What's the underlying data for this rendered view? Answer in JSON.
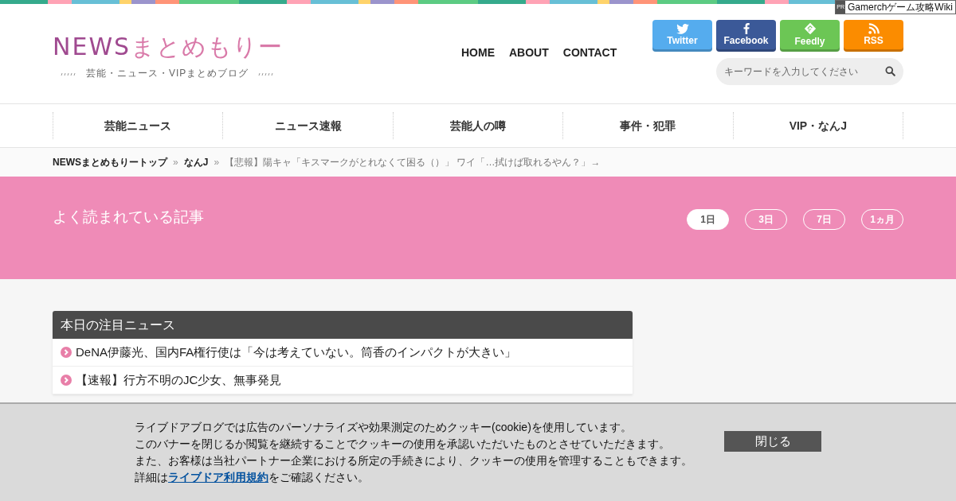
{
  "ad": {
    "mark": "PR",
    "text": "Gamerchゲーム攻略Wiki"
  },
  "header": {
    "logo_latin": "NEWS",
    "logo_kana": "まとめもりー",
    "tagline": "芸能・ニュース・VIPまとめブログ",
    "links": [
      "HOME",
      "ABOUT",
      "CONTACT"
    ],
    "social": [
      {
        "kind": "twitter",
        "label": "Twitter",
        "color": "#55acee"
      },
      {
        "kind": "facebook",
        "label": "Facebook",
        "color": "#3b5998"
      },
      {
        "kind": "feedly",
        "label": "Feedly",
        "color": "#6cc655"
      },
      {
        "kind": "rss",
        "label": "RSS",
        "color": "#fb8c00"
      }
    ],
    "search": {
      "placeholder": "キーワードを入力してください"
    }
  },
  "nav": [
    "芸能ニュース",
    "ニュース速報",
    "芸能人の噂",
    "事件・犯罪",
    "VIP・なんJ"
  ],
  "breadcrumb": {
    "links": [
      {
        "label": "NEWSまとめもりートップ",
        "separator": "»"
      },
      {
        "label": "なんJ",
        "separator": "»"
      }
    ],
    "current": "【悲報】陽キャ「キスマークがとれなくて困る（）」 ワイ「…拭けば取れるやん？」→"
  },
  "popular": {
    "title": "よく読まれている記事",
    "periods": [
      {
        "label": "1日",
        "selected": true
      },
      {
        "label": "3日",
        "selected": false
      },
      {
        "label": "7日",
        "selected": false
      },
      {
        "label": "1ヵ月",
        "selected": false
      }
    ]
  },
  "news": {
    "title": "本日の注目ニュース",
    "items": [
      "DeNA伊藤光、国内FA権行使は「今は考えていない。筒香のインパクトが大きい」",
      "【速報】行方不明のJC少女、無事発見"
    ]
  },
  "cookie": {
    "lines": [
      "ライブドアブログでは広告のパーソナライズや効果測定のためクッキー(cookie)を使用しています。",
      "このバナーを閉じるか閲覧を継続することでクッキーの使用を承認いただいたものとさせていただきます。",
      "また、お客様は当社パートナー企業における所定の手続きにより、クッキーの使用を管理することもできます。"
    ],
    "last": {
      "before": "詳細は",
      "link": "ライブドア利用規約",
      "after": "をご確認ください。"
    },
    "button": "閉じる"
  }
}
